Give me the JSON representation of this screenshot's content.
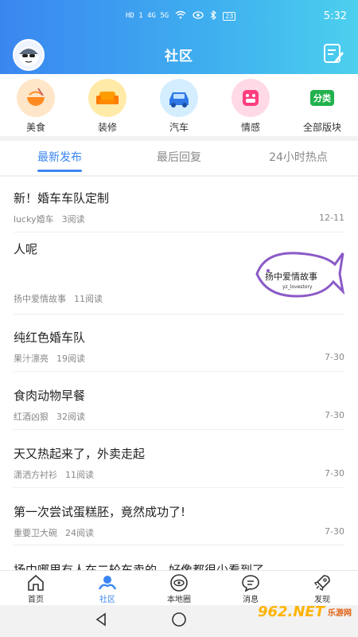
{
  "status_bar": {
    "left_signal": "HD 1  4G  5G",
    "time": "5:32",
    "battery": "23"
  },
  "header": {
    "title": "社区"
  },
  "categories": [
    {
      "label": "美食",
      "icon": "noodle-bowl-icon",
      "color": "#ffe6c8"
    },
    {
      "label": "装修",
      "icon": "sofa-icon",
      "color": "#ffeaa8"
    },
    {
      "label": "汽车",
      "icon": "car-icon",
      "color": "#d4eeff"
    },
    {
      "label": "情感",
      "icon": "heart-face-icon",
      "color": "#ffd9e6"
    },
    {
      "label": "全部版块",
      "icon": "category-icon",
      "badge": "分类",
      "color": "#ffffff"
    }
  ],
  "tabs": [
    {
      "label": "最新发布",
      "active": true
    },
    {
      "label": "最后回复",
      "active": false
    },
    {
      "label": "24小时热点",
      "active": false
    }
  ],
  "posts": [
    {
      "title": "新！婚车车队定制",
      "author": "lucky婚车",
      "reads": "3阅读",
      "date": "12-11"
    },
    {
      "title": "人呢",
      "author": "扬中爱情故事",
      "reads": "11阅读",
      "date": "",
      "image_text": "扬中爱情故事",
      "image_subtext": "yz_lovestory"
    },
    {
      "title": "纯红色婚车队",
      "author": "果汁漂亮",
      "reads": "19阅读",
      "date": "7-30"
    },
    {
      "title": "食肉动物早餐",
      "author": "红酒凶狠",
      "reads": "32阅读",
      "date": "7-30"
    },
    {
      "title": "天又热起来了，外卖走起",
      "author": "潇洒方衬衫",
      "reads": "11阅读",
      "date": "7-30"
    },
    {
      "title": "第一次尝试蛋糕胚，竟然成功了!",
      "author": "重要卫大碗",
      "reads": "24阅读",
      "date": "7-30"
    },
    {
      "title": "扬中哪里有人在二轮车卖的，好像都很少看到了",
      "author": "",
      "reads": "",
      "date": ""
    }
  ],
  "bottom_nav": [
    {
      "label": "首页",
      "icon": "home-icon",
      "active": false
    },
    {
      "label": "社区",
      "icon": "community-icon",
      "active": true
    },
    {
      "label": "本地圈",
      "icon": "eye-circle-icon",
      "active": false
    },
    {
      "label": "消息",
      "icon": "message-icon",
      "active": false
    },
    {
      "label": "发现",
      "icon": "rocket-icon",
      "active": false
    }
  ],
  "watermark": {
    "brand": "962.NET",
    "sub": "乐游网"
  },
  "colors": {
    "accent": "#3a86f0",
    "header_end": "#4cd0ee"
  }
}
